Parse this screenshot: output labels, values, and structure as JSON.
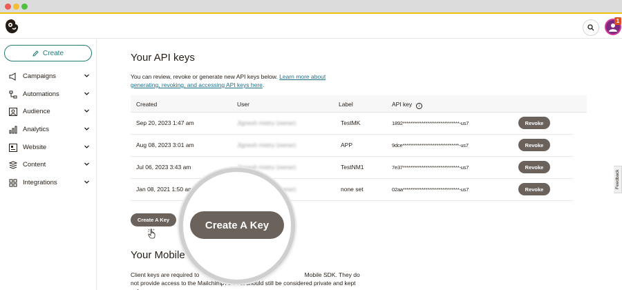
{
  "app": {
    "logo": "mailchimp-freddie-logo",
    "notification_count": "1"
  },
  "sidebar": {
    "create_label": "Create",
    "items": [
      {
        "label": "Campaigns",
        "icon": "megaphone-icon"
      },
      {
        "label": "Automations",
        "icon": "automation-icon"
      },
      {
        "label": "Audience",
        "icon": "audience-icon"
      },
      {
        "label": "Analytics",
        "icon": "bar-chart-icon"
      },
      {
        "label": "Website",
        "icon": "website-icon"
      },
      {
        "label": "Content",
        "icon": "content-icon"
      },
      {
        "label": "Integrations",
        "icon": "grid-icon"
      }
    ]
  },
  "main": {
    "title": "Your API keys",
    "intro_text": "You can review, revoke or generate new API keys below. ",
    "intro_link": "Learn more about generating, revoking, and accessing API keys here",
    "intro_end": ".",
    "table": {
      "headers": {
        "created": "Created",
        "user": "User",
        "label": "Label",
        "api_key": "API key"
      },
      "rows": [
        {
          "created": "Sep 20, 2023 1:47 am",
          "user": "Jignesh mistry (owner)",
          "label": "TestMK",
          "api_key": "1892******************************-us7",
          "action": "Revoke"
        },
        {
          "created": "Aug 08, 2023 3:01 am",
          "user": "Jignesh mistry (owner)",
          "label": "APP",
          "api_key": "9dce******************************-us7",
          "action": "Revoke"
        },
        {
          "created": "Jul 06, 2023 3:43 am",
          "user": "Jignesh mistry (owner)",
          "label": "TestNM1",
          "api_key": "7e37******************************-us7",
          "action": "Revoke"
        },
        {
          "created": "Jan 08, 2021 1:50 am",
          "user": "Jignesh mistry (owner)",
          "label": "none set",
          "api_key": "02aa******************************-us7",
          "action": "Revoke"
        }
      ]
    },
    "create_key_label": "Create A Key",
    "section2_title": "Your Mobile",
    "section2_text_part1": "Client keys are required to ",
    "section2_text_part2": "Mobile SDK. They do not provide access to the Mailchimp API but should still be considered private and kept safe.",
    "magnified_button_label": "Create A Key",
    "feedback_label": "Feedback"
  },
  "colors": {
    "accent": "#1f7a73",
    "button": "#6b625b",
    "link": "#1f6f8b",
    "border_top": "#f2c200"
  }
}
